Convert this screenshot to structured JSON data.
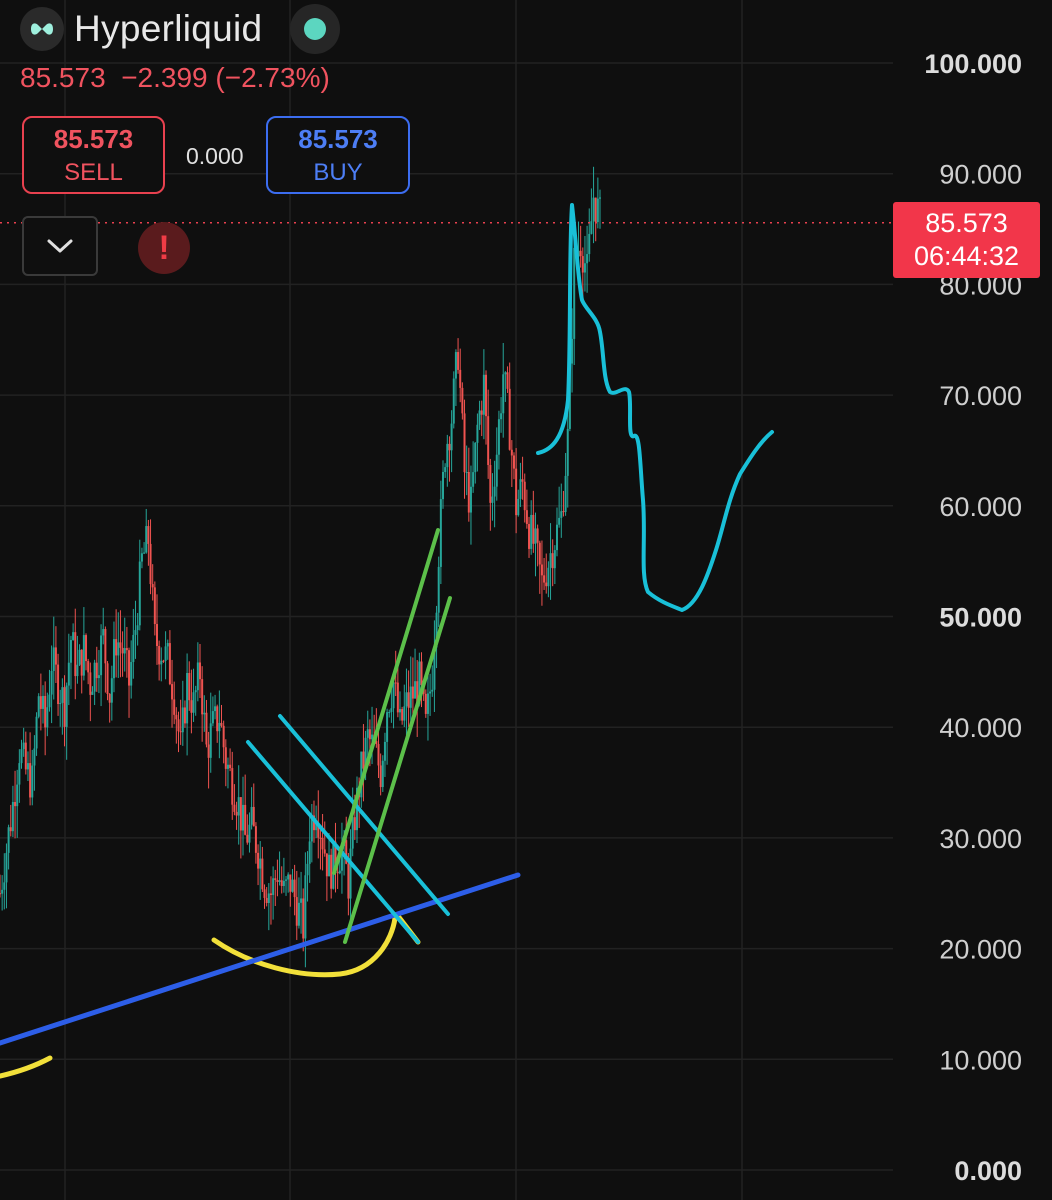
{
  "header": {
    "title": "Hyperliquid",
    "price": "85.573",
    "change": "−2.399",
    "change_pct": "(−2.73%)"
  },
  "trade": {
    "sell_price": "85.573",
    "sell_label": "SELL",
    "spread": "0.000",
    "buy_price": "85.573",
    "buy_label": "BUY"
  },
  "price_tag": {
    "price": "85.573",
    "countdown": "06:44:32"
  },
  "colors": {
    "background": "#0f0f0f",
    "up": "#26a69a",
    "down": "#ef5350",
    "sell": "#f0535f",
    "buy": "#4d7ef5",
    "drawing_cyan": "#19c0d8",
    "drawing_green": "#5cc04a",
    "drawing_blue": "#2d5ee8",
    "drawing_yellow": "#f2e03a"
  },
  "chart_data": {
    "type": "line",
    "ylim": [
      0,
      100
    ],
    "y_ticks": [
      "100.000",
      "90.000",
      "80.000",
      "70.000",
      "60.000",
      "50.000",
      "40.000",
      "30.000",
      "20.000",
      "10.000",
      "0.000"
    ],
    "bold_ticks": [
      "100.000",
      "50.000",
      "0.000"
    ],
    "last_price": 85.573,
    "series": [
      {
        "values": [
          25,
          29,
          33,
          38,
          36,
          35,
          43,
          40,
          46,
          44,
          42,
          48,
          45,
          47,
          44,
          46,
          48,
          43,
          48,
          47,
          44,
          49,
          55,
          57,
          48,
          47,
          46,
          43,
          38,
          44,
          42,
          45,
          38,
          40,
          41,
          37,
          35,
          33,
          30,
          31,
          29,
          26,
          25,
          27,
          25,
          26,
          24,
          22,
          31,
          33,
          30,
          27,
          28,
          29,
          26,
          32,
          36,
          39,
          38,
          36,
          42,
          44,
          40,
          42,
          43,
          44,
          40,
          45,
          56,
          65,
          68,
          74,
          63,
          60,
          67,
          71,
          60,
          65,
          72,
          67,
          60,
          62,
          58,
          56,
          53,
          55,
          57,
          59,
          66,
          82,
          84,
          81,
          88,
          86
        ]
      }
    ]
  }
}
